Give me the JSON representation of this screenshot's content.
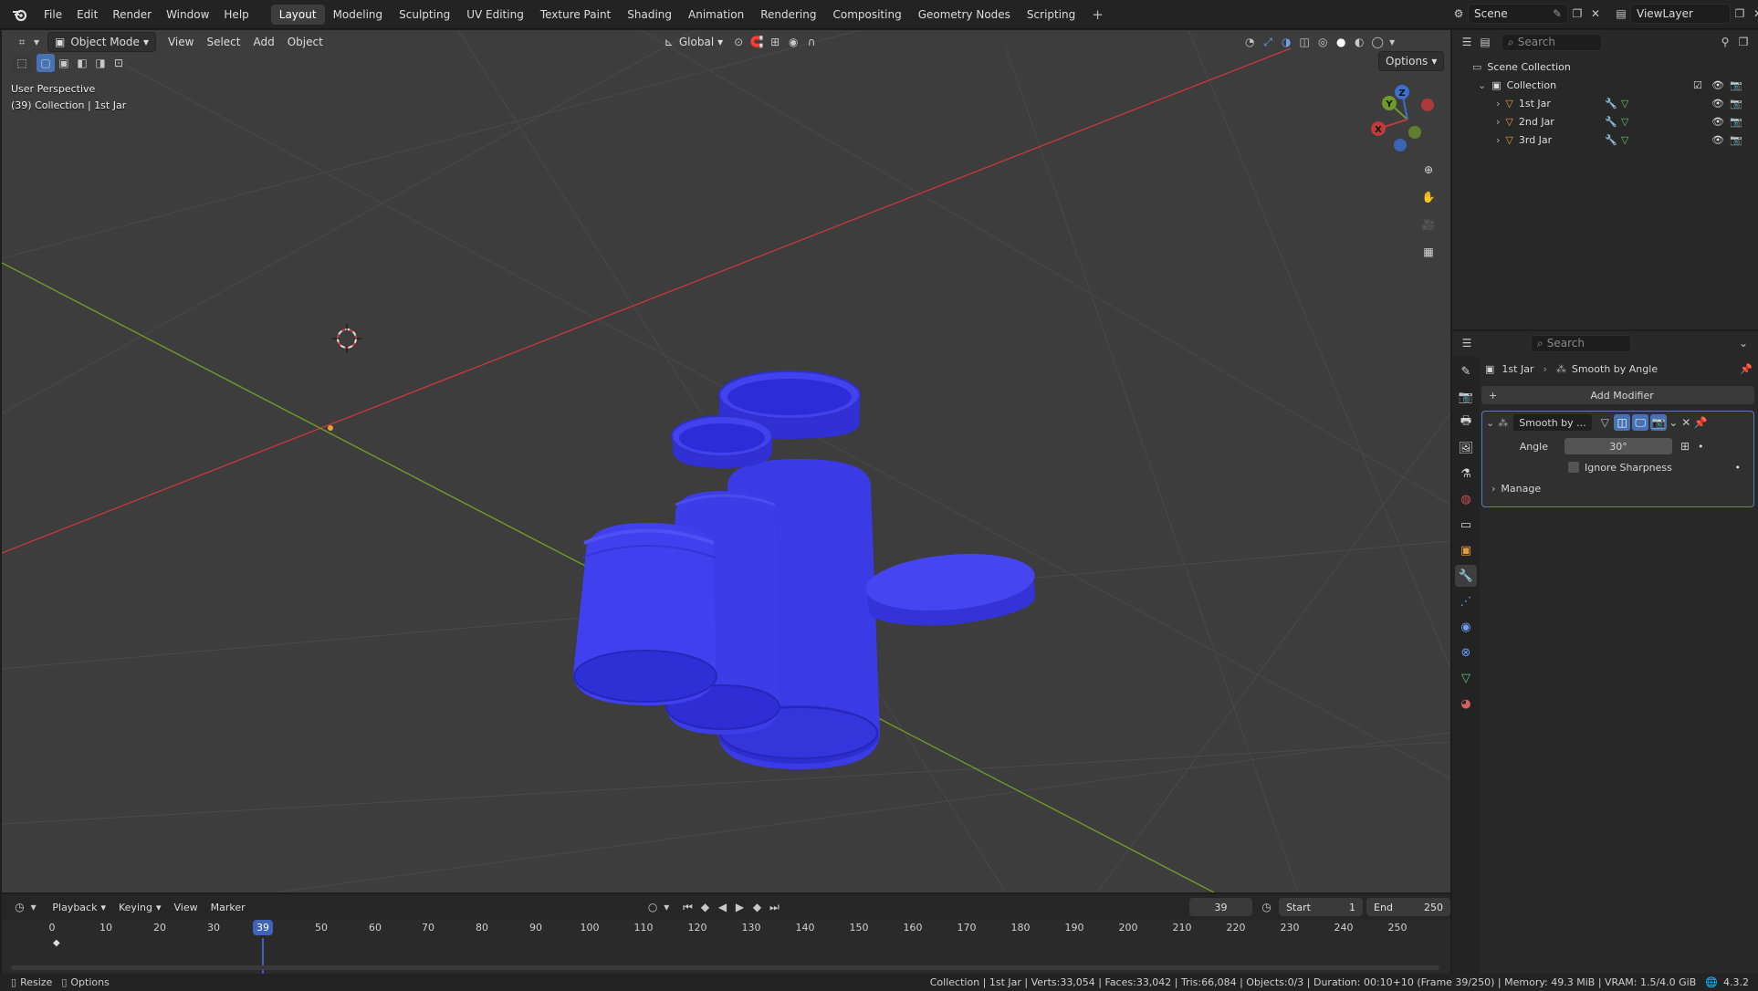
{
  "app": {
    "menus": [
      "File",
      "Edit",
      "Render",
      "Window",
      "Help"
    ],
    "workspaces": [
      "Layout",
      "Modeling",
      "Sculpting",
      "UV Editing",
      "Texture Paint",
      "Shading",
      "Animation",
      "Rendering",
      "Compositing",
      "Geometry Nodes",
      "Scripting"
    ],
    "active_workspace": "Layout",
    "add_workspace": "+",
    "scene_name": "Scene",
    "view_layer_name": "ViewLayer"
  },
  "viewport": {
    "mode": "Object Mode",
    "menus": [
      "View",
      "Select",
      "Add",
      "Object"
    ],
    "transform_orientation": "Global",
    "options_label": "Options",
    "info_line1": "User Perspective",
    "info_line2": "(39) Collection | 1st Jar",
    "gizmo_axes": {
      "x": "X",
      "y": "Y",
      "z": "Z"
    },
    "colors": {
      "jar": "#3b3be6",
      "x_axis": "#c0393b",
      "y_axis": "#6f9a2a",
      "background": "#3d3d3d"
    }
  },
  "outliner": {
    "search_placeholder": "Search",
    "scene_collection": "Scene Collection",
    "collection": "Collection",
    "objects": [
      "1st Jar",
      "2nd Jar",
      "3rd Jar"
    ]
  },
  "properties": {
    "search_placeholder": "Search",
    "breadcrumb_object": "1st Jar",
    "breadcrumb_modifier": "Smooth by Angle",
    "add_modifier": "Add Modifier",
    "modifier_name": "Smooth by ...",
    "angle_label": "Angle",
    "angle_value": "30°",
    "ignore_sharpness": "Ignore Sharpness",
    "manage": "Manage"
  },
  "timeline": {
    "menus": [
      "Playback",
      "Keying",
      "View",
      "Marker"
    ],
    "current_frame": "39",
    "start_label": "Start",
    "start_value": "1",
    "end_label": "End",
    "end_value": "250",
    "ticks": [
      "0",
      "10",
      "20",
      "30",
      "50",
      "60",
      "70",
      "80",
      "90",
      "100",
      "110",
      "120",
      "130",
      "140",
      "150",
      "160",
      "170",
      "180",
      "190",
      "200",
      "210",
      "220",
      "230",
      "240",
      "250"
    ]
  },
  "statusbar": {
    "left1": "Resize",
    "left2": "Options",
    "stats": "Collection | 1st Jar | Verts:33,054 | Faces:33,042 | Tris:66,084 | Objects:0/3 | Duration: 00:10+10 (Frame 39/250) | Memory: 49.3 MiB | VRAM: 1.5/4.0 GiB",
    "version": "4.3.2"
  }
}
